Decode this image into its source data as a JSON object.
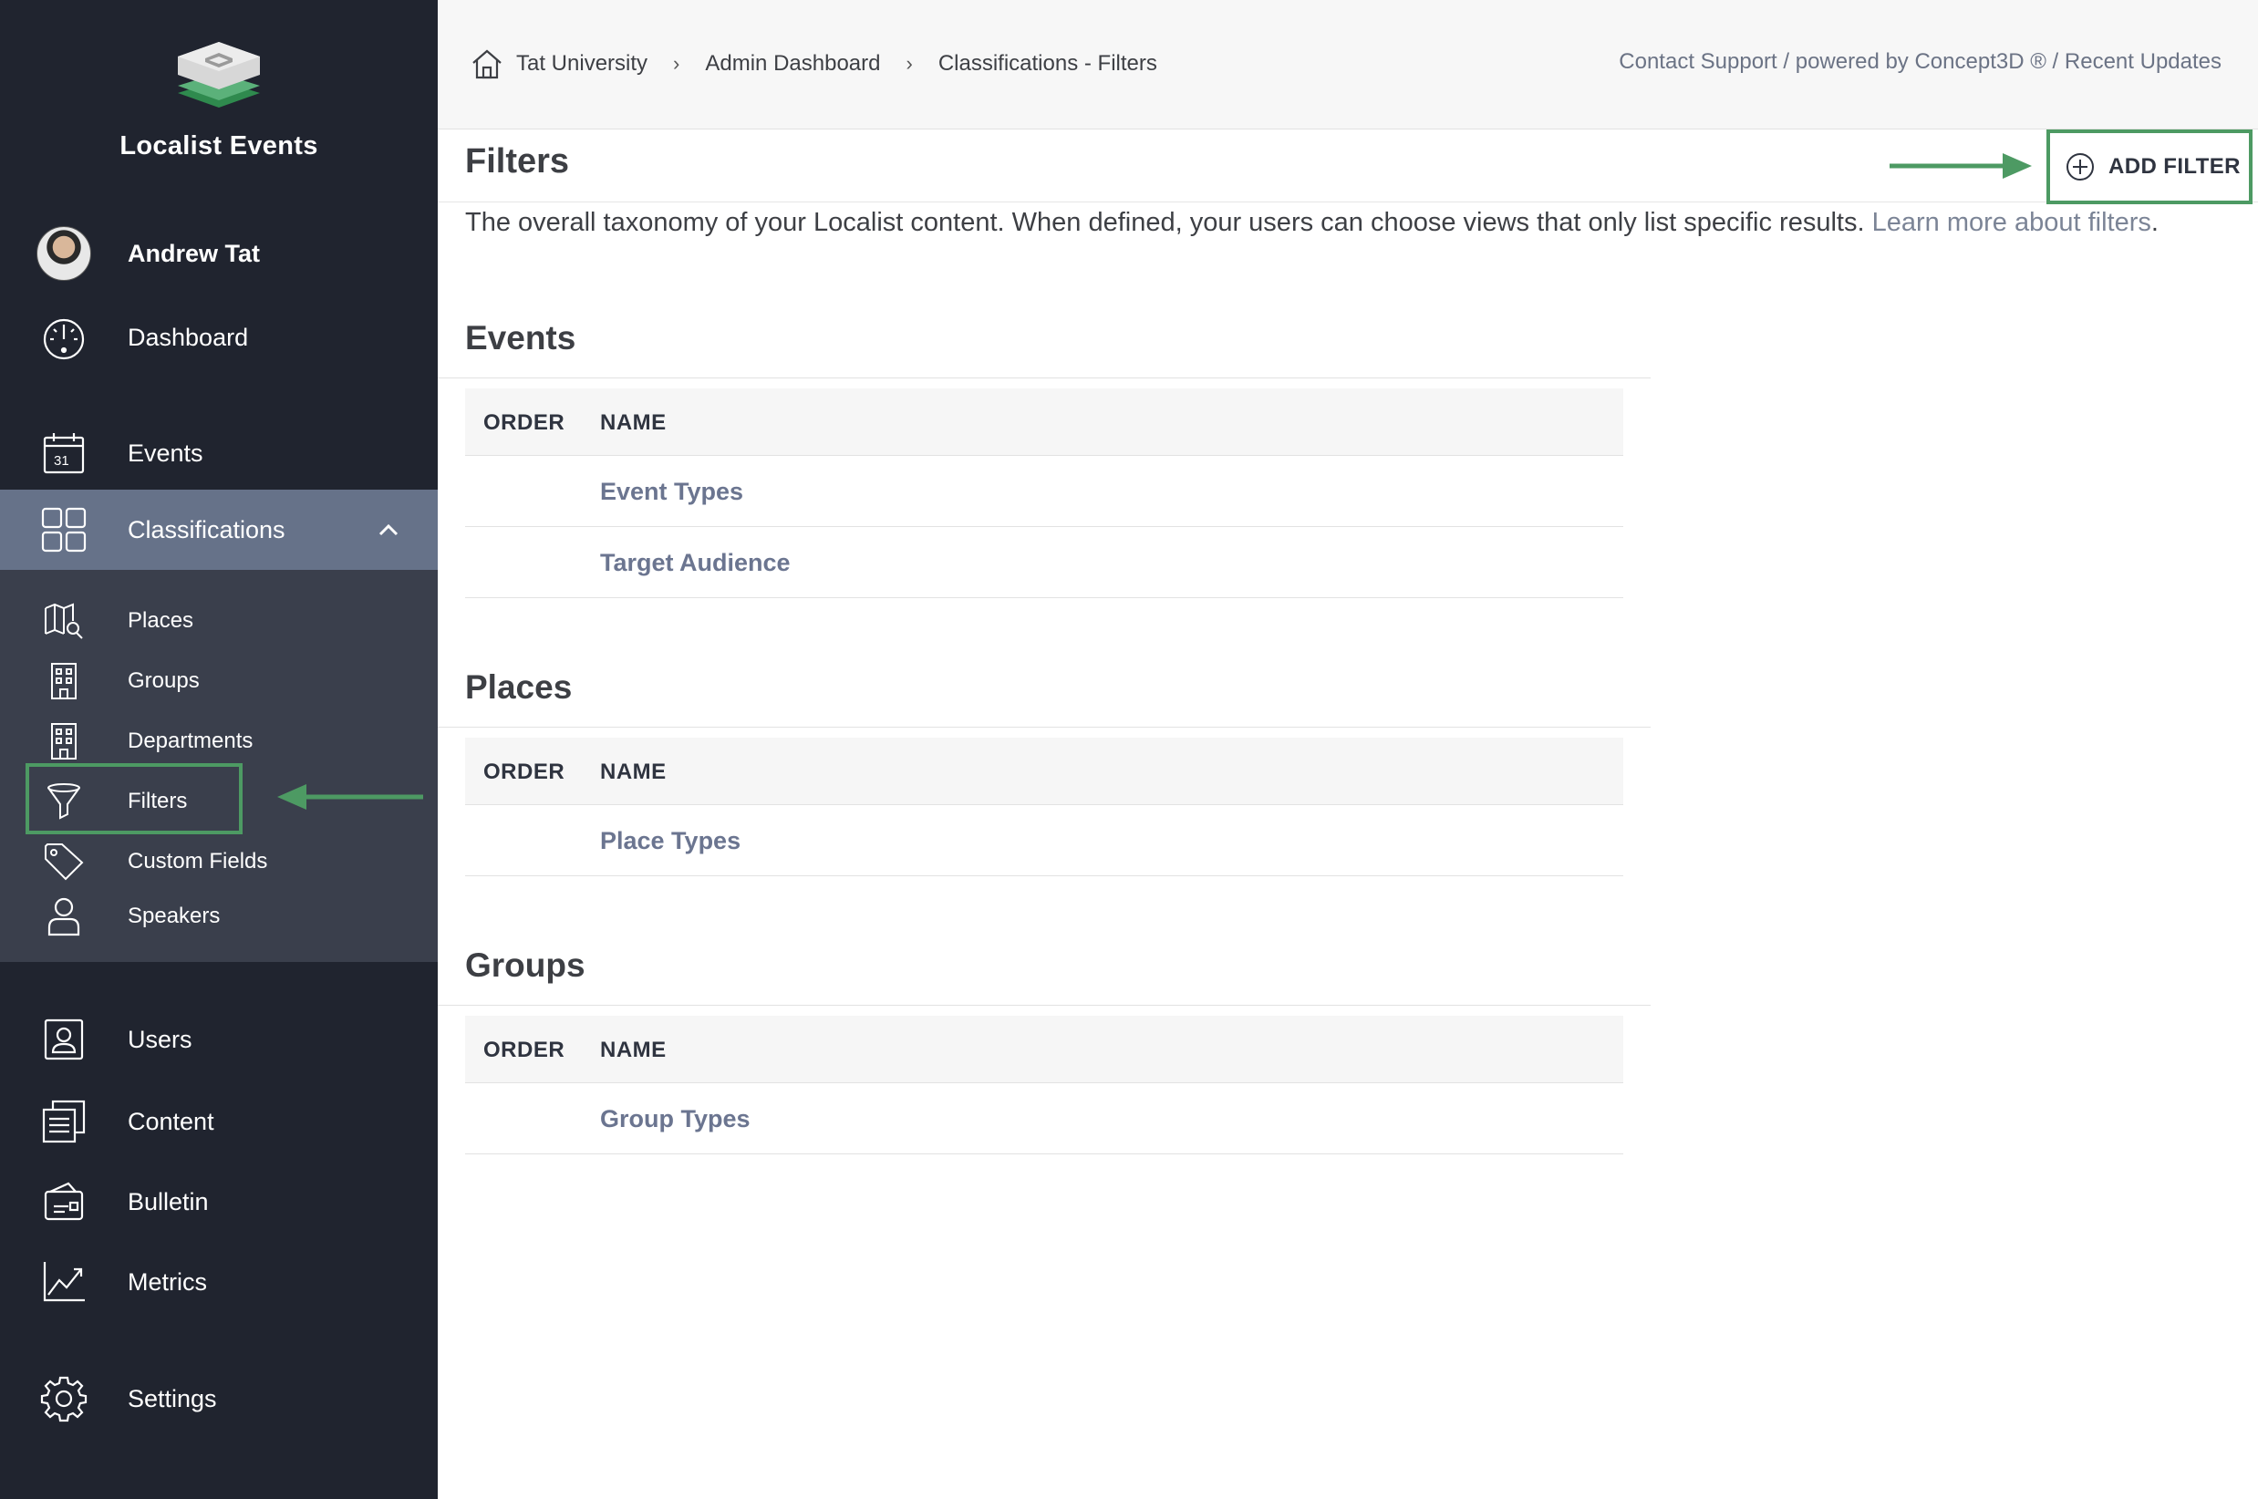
{
  "app": {
    "brand_name": "Localist Events"
  },
  "user": {
    "name": "Andrew Tat"
  },
  "sidebar": {
    "items": [
      {
        "label": "Dashboard",
        "icon": "gauge-icon"
      },
      {
        "label": "Events",
        "icon": "calendar-icon",
        "badge": "31"
      },
      {
        "label": "Classifications",
        "icon": "grid-icon",
        "active": true
      },
      {
        "label": "Users",
        "icon": "user-card-icon"
      },
      {
        "label": "Content",
        "icon": "documents-icon"
      },
      {
        "label": "Bulletin",
        "icon": "bulletin-icon"
      },
      {
        "label": "Metrics",
        "icon": "line-chart-icon"
      },
      {
        "label": "Settings",
        "icon": "gear-icon"
      }
    ],
    "sub_items": [
      {
        "label": "Places",
        "icon": "map-search-icon"
      },
      {
        "label": "Groups",
        "icon": "building-icon"
      },
      {
        "label": "Departments",
        "icon": "building-icon"
      },
      {
        "label": "Filters",
        "icon": "funnel-icon",
        "active": true
      },
      {
        "label": "Custom Fields",
        "icon": "tag-icon"
      },
      {
        "label": "Speakers",
        "icon": "person-icon"
      }
    ]
  },
  "breadcrumb": [
    "Tat University",
    "Admin Dashboard",
    "Classifications - Filters"
  ],
  "breadcrumb_separator": "›",
  "top_links": "Contact Support / powered by Concept3D ® / Recent Updates",
  "page": {
    "title": "Filters",
    "add_button": "ADD FILTER",
    "description": "The overall taxonomy of your Localist content. When defined, your users can choose views that only list specific results.",
    "learn_more": "Learn more about filters",
    "period": "."
  },
  "table_headers": {
    "order": "ORDER",
    "name": "NAME"
  },
  "sections": [
    {
      "title": "Events",
      "rows": [
        "Event Types",
        "Target Audience"
      ]
    },
    {
      "title": "Places",
      "rows": [
        "Place Types"
      ]
    },
    {
      "title": "Groups",
      "rows": [
        "Group Types"
      ]
    }
  ],
  "colors": {
    "sidebar_bg": "#20242f",
    "active_bg": "#667289",
    "subnav_bg": "#3a3f4c",
    "annotation_green": "#4d9a63",
    "link_gray": "#6b7590"
  }
}
